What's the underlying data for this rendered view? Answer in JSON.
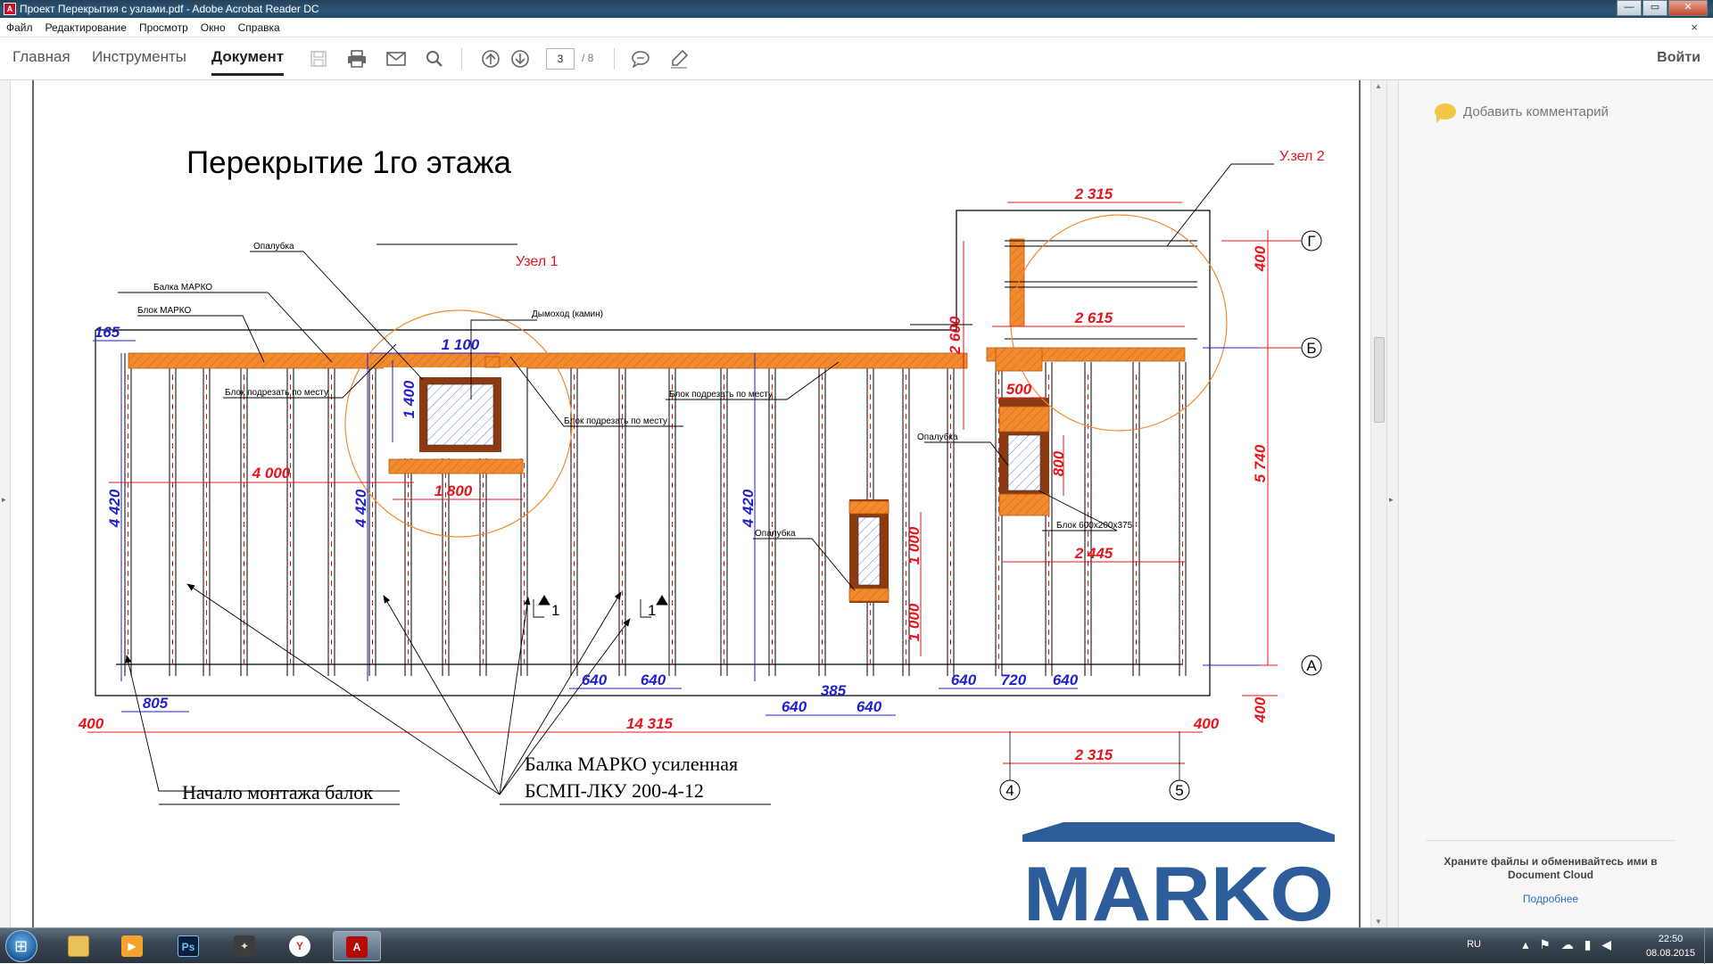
{
  "window": {
    "title": "Проект Перекрытия с узлами.pdf - Adobe Acrobat Reader DC",
    "minimize": "—",
    "maximize": "▭",
    "close": "✕"
  },
  "menu": {
    "items": [
      "Файл",
      "Редактирование",
      "Просмотр",
      "Окно",
      "Справка"
    ],
    "close": "×"
  },
  "toolbar": {
    "tabs": [
      "Главная",
      "Инструменты",
      "Документ"
    ],
    "active_tab": "Документ",
    "page_current": "3",
    "page_total": "/ 8",
    "sign_in": "Войти"
  },
  "drawing": {
    "title": "Перекрытие 1го этажа",
    "callouts": {
      "opalubka": "Опалубка",
      "balka": "Балка МАРКО",
      "blok": "Блок МАРКО",
      "dymohod": "Дымоход (камин)",
      "uzel1": "Узел 1",
      "uzel2": "У.зел 2",
      "blok_podrezat": "Блок подрезать по месту",
      "blok_size": "Блок 600x200x375",
      "nachalo": "Начало монтажа балок",
      "usil_1": "Балка МАРКО усиленная",
      "usil_2": "БСМП-ЛКУ 200-4-12",
      "section": "1"
    },
    "dims_red": {
      "d4000": "4 000",
      "d1800": "1 800",
      "d2315": "2 315",
      "d2615": "2 615",
      "d500": "500",
      "d800": "800",
      "d2445": "2 445",
      "d2600": "2 600",
      "d1000a": "1 000",
      "d1000b": "1 000",
      "d400l": "400",
      "d14315": "14 315",
      "d400r": "400",
      "d2315b": "2 315",
      "d400top": "400",
      "d5740": "5 740",
      "d400bot": "400"
    },
    "dims_blue": {
      "d165": "165",
      "d1100": "1 100",
      "d1400": "1 400",
      "d4420a": "4 420",
      "d4420b": "4 420",
      "d4420c": "4 420",
      "d805": "805",
      "d640a": "640",
      "d640b": "640",
      "d640c": "640",
      "d385": "385",
      "d640d": "640",
      "d640e": "640",
      "d720": "720",
      "d640f": "640"
    },
    "axes": [
      "Г",
      "Б",
      "А",
      "4",
      "5"
    ],
    "logo": "MARKO"
  },
  "right_pane": {
    "add_comment": "Добавить комментарий",
    "cloud_message": "Храните файлы и обменивайтесь ими в Document Cloud",
    "cloud_link": "Подробнее"
  },
  "taskbar": {
    "apps": [
      "explorer",
      "media-player",
      "photoshop",
      "world-of-tanks",
      "yandex-browser",
      "acrobat-reader"
    ],
    "lang": "RU",
    "time": "22:50",
    "date": "08.08.2015"
  },
  "colors": {
    "dim_red": "#e8141c",
    "dim_blue": "#1f1fcf",
    "block_orange": "#f28a2e",
    "formwork_brown": "#8b3a12",
    "logo_blue": "#2c5d9a"
  }
}
